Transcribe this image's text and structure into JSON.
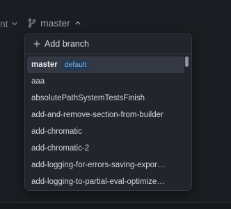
{
  "topbar": {
    "left_crumb": "nt",
    "branch_name": "master"
  },
  "dropdown": {
    "add_label": "Add branch",
    "default_badge": "default",
    "selected_progress": 0.0,
    "branches": [
      "master",
      "aaa",
      "absolutePathSystemTestsFinish",
      "add-and-remove-section-from-builder",
      "add-chromatic",
      "add-chromatic-2",
      "add-logging-for-errors-saving-expor…",
      "add-logging-to-partial-eval-optimize…"
    ]
  },
  "colors": {
    "background": "#1b1d22",
    "menu_bg": "#22252b",
    "selected_bg": "#343843",
    "badge_text": "#79b8f0",
    "badge_bg": "#223a55"
  }
}
